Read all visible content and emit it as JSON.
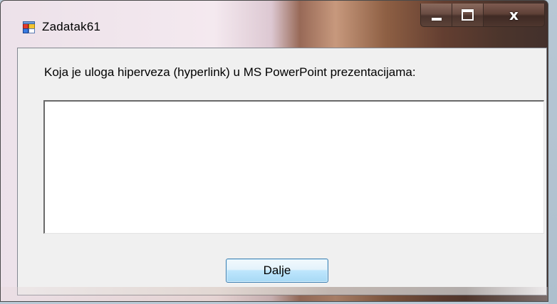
{
  "window": {
    "title": "Zadatak61",
    "caption": {
      "minimize_icon": "minimize-icon",
      "maximize_icon": "maximize-icon",
      "close_label": "x"
    }
  },
  "form": {
    "question": "Koja je uloga hiperveza (hyperlink) u MS PowerPoint prezentacijama:",
    "answer_value": "",
    "next_label": "Dalje"
  },
  "colors": {
    "client_bg": "#f0f0f0",
    "button_border": "#3c7fb1",
    "button_gradient_top": "#e3f2fb",
    "button_gradient_bottom": "#a7d9f5"
  },
  "icons": {
    "app": "app-form-icon"
  }
}
